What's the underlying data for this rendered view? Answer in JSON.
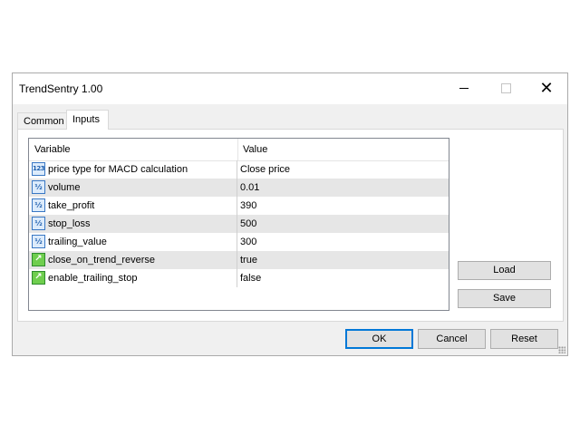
{
  "window": {
    "title": "TrendSentry 1.00",
    "controls": {
      "minimize": "",
      "maximize": "",
      "close": "✕"
    }
  },
  "tabs": [
    {
      "label": "Common",
      "active": false
    },
    {
      "label": "Inputs",
      "active": true
    }
  ],
  "grid": {
    "columns": {
      "variable": "Variable",
      "value": "Value"
    },
    "rows": [
      {
        "icon": "integer-type-icon",
        "icon_glyph": "123",
        "variable": "price type for MACD calculation",
        "value": "Close price"
      },
      {
        "icon": "fraction-type-icon",
        "icon_glyph": "½",
        "variable": "volume",
        "value": "0.01"
      },
      {
        "icon": "fraction-type-icon",
        "icon_glyph": "½",
        "variable": "take_profit",
        "value": "390"
      },
      {
        "icon": "fraction-type-icon",
        "icon_glyph": "½",
        "variable": "stop_loss",
        "value": "500"
      },
      {
        "icon": "fraction-type-icon",
        "icon_glyph": "½",
        "variable": "trailing_value",
        "value": "300"
      },
      {
        "icon": "boolean-type-icon",
        "icon_glyph": "↗",
        "variable": "close_on_trend_reverse",
        "value": "true"
      },
      {
        "icon": "boolean-type-icon",
        "icon_glyph": "↗",
        "variable": "enable_trailing_stop",
        "value": "false"
      }
    ]
  },
  "side_buttons": {
    "load": "Load",
    "save": "Save"
  },
  "footer_buttons": {
    "ok": "OK",
    "cancel": "Cancel",
    "reset": "Reset"
  },
  "colors": {
    "accent": "#0078d7",
    "alt_row": "#e6e6e6",
    "int_icon": "#3a78c4",
    "bool_icon": "#6fce4e"
  }
}
